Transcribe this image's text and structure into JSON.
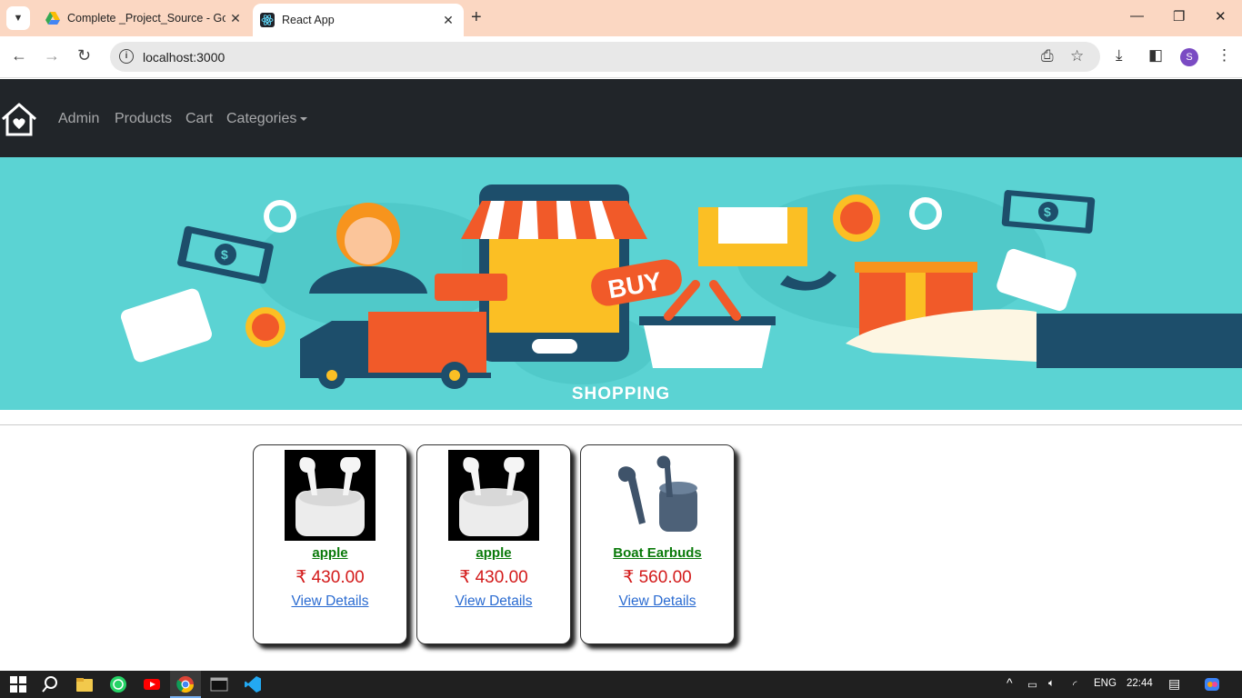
{
  "browser": {
    "tabs": [
      {
        "title": "Complete _Project_Source - Go",
        "favicon": "google-drive-icon"
      },
      {
        "title": "React App",
        "favicon": "react-icon",
        "active": true
      }
    ],
    "url": "localhost:3000"
  },
  "navbar": {
    "brand_icon": "home-heart-icon",
    "links": [
      "Admin",
      "Products",
      "Cart",
      "Categories"
    ]
  },
  "banner": {
    "caption": "SHOPPING",
    "buy_text": "BUY",
    "background": "#5bd3d3"
  },
  "products": [
    {
      "name": "apple",
      "price": "₹ 430.00",
      "link": "View Details",
      "image": "airpods-pro-image"
    },
    {
      "name": "apple",
      "price": "₹ 430.00",
      "link": "View Details",
      "image": "airpods-pro-image"
    },
    {
      "name": "Boat Earbuds",
      "price": "₹ 560.00",
      "link": "View Details",
      "image": "boat-earbuds-image"
    }
  ],
  "taskbar": {
    "language": "ENG",
    "time": "22:44"
  },
  "colors": {
    "navbar_bg": "#212529",
    "product_name": "#0a7a0a",
    "price": "#d31a1a",
    "link": "#2a6bd1"
  }
}
